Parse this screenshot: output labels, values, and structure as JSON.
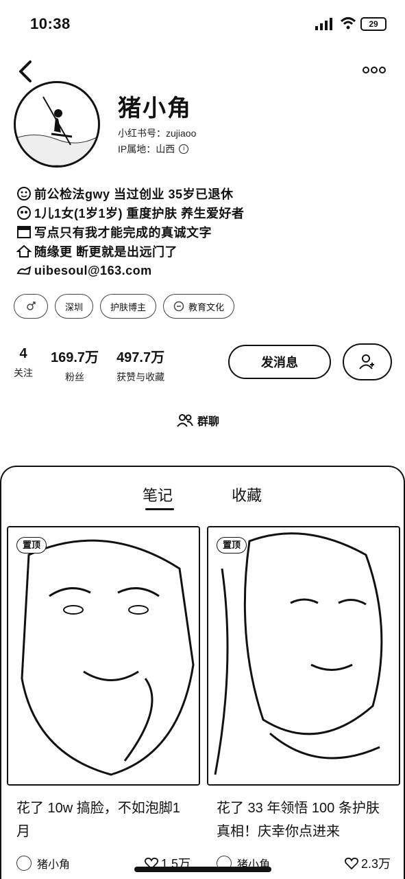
{
  "status_bar": {
    "time": "10:38",
    "battery": "29"
  },
  "profile": {
    "nickname": "猪小角",
    "red_id": "小红书号：zujiaoo",
    "ip_location": "IP属地：山西"
  },
  "bio": [
    {
      "icon": "emoji-face-icon",
      "text": "前公检法gwy 当过创业 35岁已退休"
    },
    {
      "icon": "emoji-people-icon",
      "text": "1儿1女(1岁1岁) 重度护肤 养生爱好者"
    },
    {
      "icon": "emoji-note-icon",
      "text": "写点只有我才能完成的真诚文字"
    },
    {
      "icon": "emoji-house-icon",
      "text": "随缘更 断更就是出远门了"
    },
    {
      "icon": "emoji-mail-icon",
      "text": "uibesoul@163.com"
    }
  ],
  "tags": [
    {
      "label": ""
    },
    {
      "label": "深圳"
    },
    {
      "label": "护肤博主"
    },
    {
      "label": "教育文化"
    }
  ],
  "stats": [
    {
      "value": "4",
      "label": "关注"
    },
    {
      "value": "169.7万",
      "label": "粉丝"
    },
    {
      "value": "497.7万",
      "label": "获赞与收藏"
    }
  ],
  "actions": {
    "message": "发消息",
    "group_chat": "群聊"
  },
  "tabs": [
    {
      "label": "笔记",
      "active": true
    },
    {
      "label": "收藏",
      "active": false
    }
  ],
  "notes": [
    {
      "badge": "置顶",
      "title": "花了 10w 搞脸，不如泡脚1月",
      "author": "猪小角",
      "likes": "1.5万"
    },
    {
      "badge": "置顶",
      "title": "花了 33 年领悟 100 条护肤真相！庆幸你点进来",
      "author": "猪小角",
      "likes": "2.3万"
    }
  ],
  "colors": {
    "ink": "#111111",
    "background": "#ffffff"
  }
}
